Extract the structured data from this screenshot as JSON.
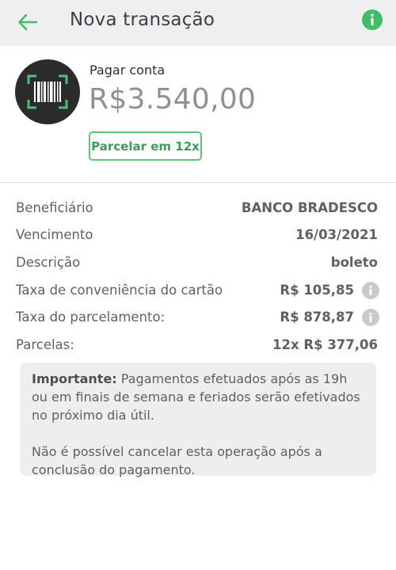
{
  "header": {
    "title": "Nova transação",
    "back_icon": "arrow-left-icon",
    "info_icon": "info-icon",
    "accent_color": "#3fbf64"
  },
  "payment": {
    "label": "Pagar conta",
    "amount": "R$3.540,00",
    "icon": "barcode-scan-icon",
    "installment_button": "Parcelar em 12x"
  },
  "details": [
    {
      "label": "Beneficiário",
      "value": "BANCO BRADESCO",
      "info": false
    },
    {
      "label": "Vencimento",
      "value": "16/03/2021",
      "info": false
    },
    {
      "label": "Descrição",
      "value": "boleto",
      "info": false
    },
    {
      "label": "Taxa de conveniência do cartão",
      "value": "R$ 105,85",
      "info": true
    },
    {
      "label": "Taxa do parcelamento:",
      "value": "R$ 878,87",
      "info": true
    },
    {
      "label": "Parcelas:",
      "value": "12x R$ 377,06",
      "info": false
    }
  ],
  "notice": {
    "heading": "Importante:",
    "text": "Pagamentos efetuados após as 19h ou em finais de semana e feriados serão efetivados no próximo dia útil.",
    "text2": "Não é possível cancelar esta operação após a conclusão do pagamento."
  }
}
